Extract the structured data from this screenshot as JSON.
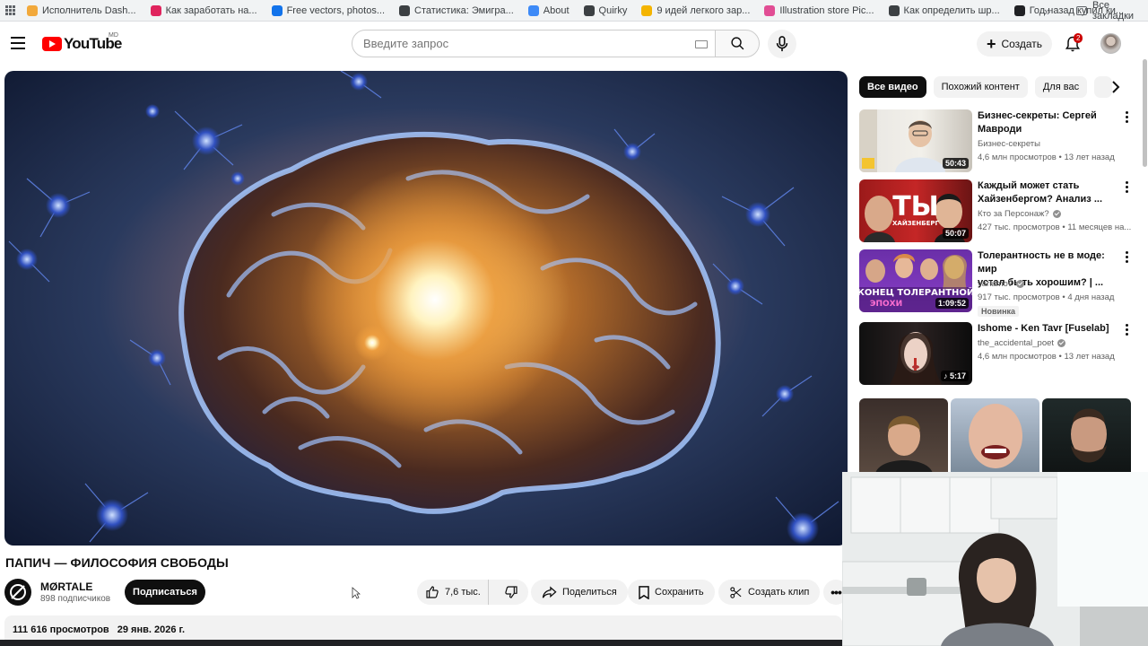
{
  "bookmarks": {
    "items": [
      {
        "label": "Исполнитель Dash...",
        "color": "#f2a93b"
      },
      {
        "label": "Как заработать на...",
        "color": "#e0245e"
      },
      {
        "label": "Free vectors, photos...",
        "color": "#1273eb"
      },
      {
        "label": "Статистика: Эмигра...",
        "color": "#3c4043"
      },
      {
        "label": "About",
        "color": "#3d8af7"
      },
      {
        "label": "Quirky",
        "color": "#3c4043"
      },
      {
        "label": "9 идей легкого зар...",
        "color": "#f4b400"
      },
      {
        "label": "Illustration store Pic...",
        "color": "#e14d94"
      },
      {
        "label": "Как определить шр...",
        "color": "#3c4043"
      },
      {
        "label": "Год назад купил ки...",
        "color": "#202124"
      }
    ],
    "more_label": "»",
    "all_label": "Все закладки"
  },
  "masthead": {
    "logo_text": "YouTube",
    "logo_region": "MD",
    "search_placeholder": "Введите запрос",
    "create_label": "Создать",
    "notifications_count": "2"
  },
  "video": {
    "title": "ПАПИЧ — ФИЛОСОФИЯ СВОБОДЫ",
    "channel": "MØRTALE",
    "subscribers": "898 подписчиков",
    "subscribe_label": "Подписаться",
    "likes": "7,6 тыс.",
    "share_label": "Поделиться",
    "save_label": "Сохранить",
    "clip_label": "Создать клип",
    "views": "111 616 просмотров",
    "date": "29 янв. 2026 г."
  },
  "chips": [
    "Все видео",
    "Похожий контент",
    "Для вас"
  ],
  "recommendations": [
    {
      "title_line1": "Бизнес-секреты: Сергей",
      "title_line2": "Мавроди",
      "channel": "Бизнес-секреты",
      "meta": "4,6 млн просмотров • 13 лет назад",
      "duration": "50:43",
      "verified": false,
      "badge": ""
    },
    {
      "title_line1": "Каждый может стать",
      "title_line2": "Хайзенбергом? Анализ ...",
      "channel": "Кто за Персонаж?",
      "meta": "427 тыс. просмотров • 11 месяцев на...",
      "duration": "50:07",
      "verified": true,
      "badge": ""
    },
    {
      "title_line1": "Толерантность не в моде: мир",
      "title_line2": "устал быть хорошим? | ...",
      "channel": "varlamov",
      "meta": "917 тыс. просмотров • 4 дня назад",
      "duration": "1:09:52",
      "verified": true,
      "badge": "Новинка"
    },
    {
      "title_line1": "Ishome - Ken Tavr [Fuselab]",
      "title_line2": "",
      "channel": "the_accidental_poet",
      "meta": "4,6 млн просмотров • 13 лет назад",
      "duration": "5:17",
      "verified": true,
      "badge": ""
    }
  ],
  "thumb_text": {
    "heisenberg_big": "ТЫ",
    "heisenberg_small": "ХАЙЗЕНБЕРГ",
    "tolerance_line1": "КОНЕЦ ТОЛЕРАНТНОЙ",
    "tolerance_line2": "ЭПОХИ"
  },
  "colors": {
    "brand_red": "#ff0000",
    "text_primary": "#0f0f0f",
    "text_secondary": "#606060",
    "chip_bg": "#f2f2f2",
    "badge_red": "#cc0000"
  }
}
